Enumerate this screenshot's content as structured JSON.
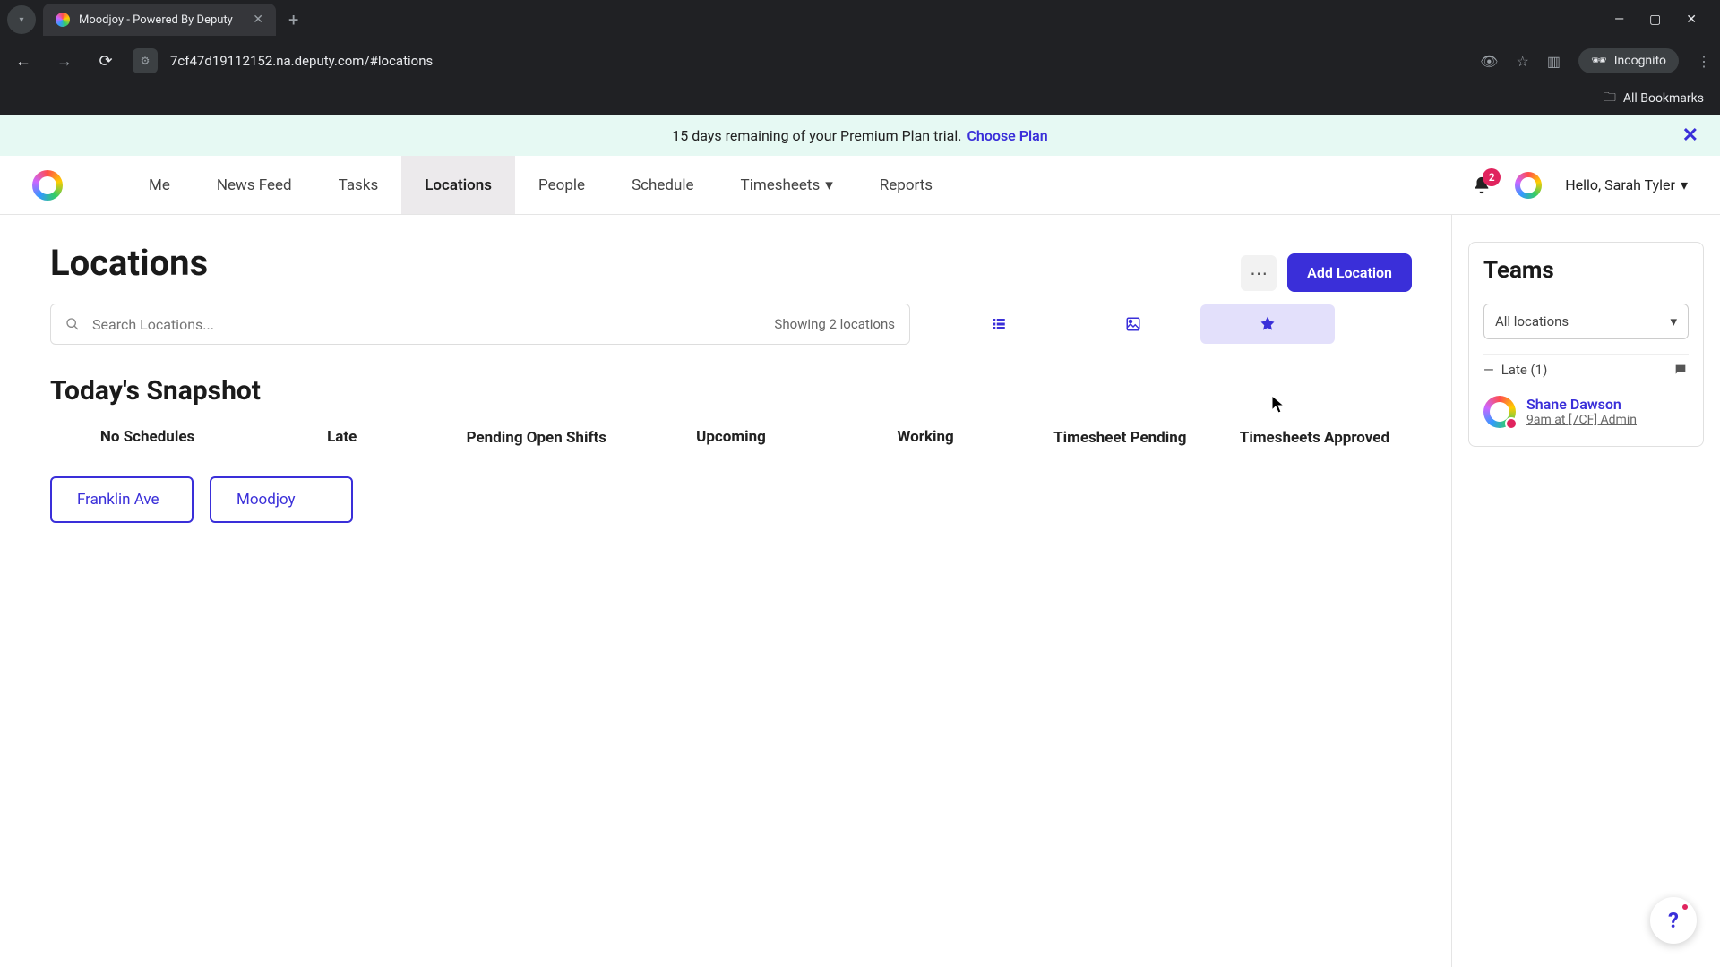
{
  "browser": {
    "tab_title": "Moodjoy - Powered By Deputy",
    "url": "7cf47d19112152.na.deputy.com/#locations",
    "incognito_label": "Incognito",
    "all_bookmarks": "All Bookmarks"
  },
  "banner": {
    "text": "15 days remaining of your Premium Plan trial.",
    "link": "Choose Plan"
  },
  "nav": {
    "items": [
      "Me",
      "News Feed",
      "Tasks",
      "Locations",
      "People",
      "Schedule",
      "Timesheets",
      "Reports"
    ],
    "active_index": 3,
    "notification_count": "2",
    "greeting": "Hello, Sarah Tyler"
  },
  "page": {
    "title": "Locations",
    "add_button": "Add Location",
    "search_placeholder": "Search Locations...",
    "showing": "Showing 2 locations"
  },
  "snapshot": {
    "title": "Today's Snapshot",
    "columns": [
      "No Schedules",
      "Late",
      "Pending Open Shifts",
      "Upcoming",
      "Working",
      "Timesheet Pending",
      "Timesheets Approved"
    ],
    "location_chips": [
      "Franklin Ave",
      "Moodjoy"
    ]
  },
  "sidebar": {
    "title": "Teams",
    "filter_value": "All locations",
    "late_label": "Late (1)",
    "person": {
      "name": "Shane Dawson",
      "sub": "9am at [7CF] Admin"
    }
  }
}
